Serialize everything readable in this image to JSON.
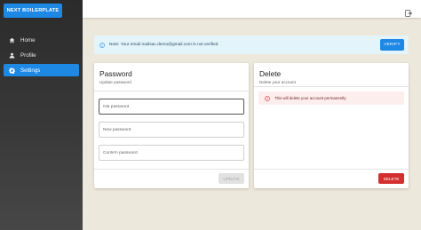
{
  "brand": {
    "label": "NEXT BOILERPLATE"
  },
  "sidebar": {
    "items": [
      {
        "label": "Home",
        "icon": "home-icon",
        "active": false
      },
      {
        "label": "Profile",
        "icon": "person-icon",
        "active": false
      },
      {
        "label": "Settings",
        "icon": "gear-icon",
        "active": true
      }
    ]
  },
  "topbar": {
    "icon": "logout-icon"
  },
  "alert": {
    "icon": "info-icon",
    "message": "Note: Your email mailsac.demo@gmail.com is not verified",
    "button_label": "VERIFY"
  },
  "password_card": {
    "title": "Password",
    "subtitle": "Update password",
    "fields": [
      {
        "placeholder": "Old password",
        "value": ""
      },
      {
        "placeholder": "New password",
        "value": ""
      },
      {
        "placeholder": "Confirm password",
        "value": ""
      }
    ],
    "button_label": "UPDATE"
  },
  "delete_card": {
    "title": "Delete",
    "subtitle": "Delete your account",
    "warning_icon": "error-icon",
    "warning": "This will delete your account permanently",
    "button_label": "DELETE"
  },
  "colors": {
    "primary": "#1e88e5",
    "danger": "#d32f2f",
    "background": "#ece8dc",
    "sidebar": "#2f2f2f"
  }
}
